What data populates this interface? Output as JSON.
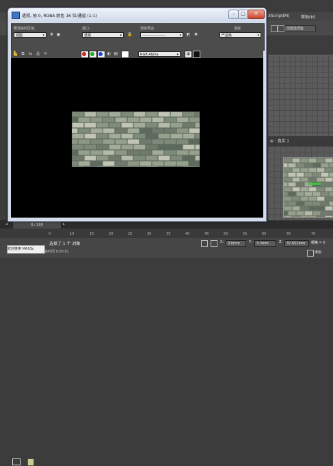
{
  "window": {
    "title": "透视, 帧 0, RGBA 颜色 16 位/通道 (1:1)",
    "min_label": "–",
    "max_label": "□",
    "close_label": "✕"
  },
  "controls": {
    "area_label": "要渲染的区域:",
    "area_value": "视图",
    "viewport_label": "视口:",
    "viewport_value": "透视",
    "preset_label": "渲染预设:",
    "preset_value": "-------------------",
    "render_label": "渲染",
    "render_value": "产品级",
    "channel_value": "RGB Alpha"
  },
  "colors": {
    "red": "#d22222",
    "green": "#22aa22",
    "blue": "#2244dd"
  },
  "background": {
    "menu_items": [
      "XScript(M)",
      "帮助(H)"
    ],
    "toolbar_field": "创建选择集",
    "viewport_label": "⊕ · 真实 ]"
  },
  "timeline": {
    "slider_label": "0 / 100",
    "ticks": [
      "0",
      "10",
      "15",
      "20",
      "25",
      "30",
      "35",
      "40",
      "45",
      "50",
      "55",
      "60",
      "65",
      "70"
    ]
  },
  "status": {
    "selected_text": "选择了 1 个 对象",
    "render_time": "渲染时间 0:00:01",
    "welcome": "欢迎使用 MAXSc",
    "x_label": "X:",
    "x_value": "0.0mm",
    "y_label": "Y:",
    "y_value": "3.3mm",
    "z_label": "Z:",
    "z_value": "37.652mm",
    "grid_text": "栅格 = 0",
    "add_time": "添加"
  }
}
